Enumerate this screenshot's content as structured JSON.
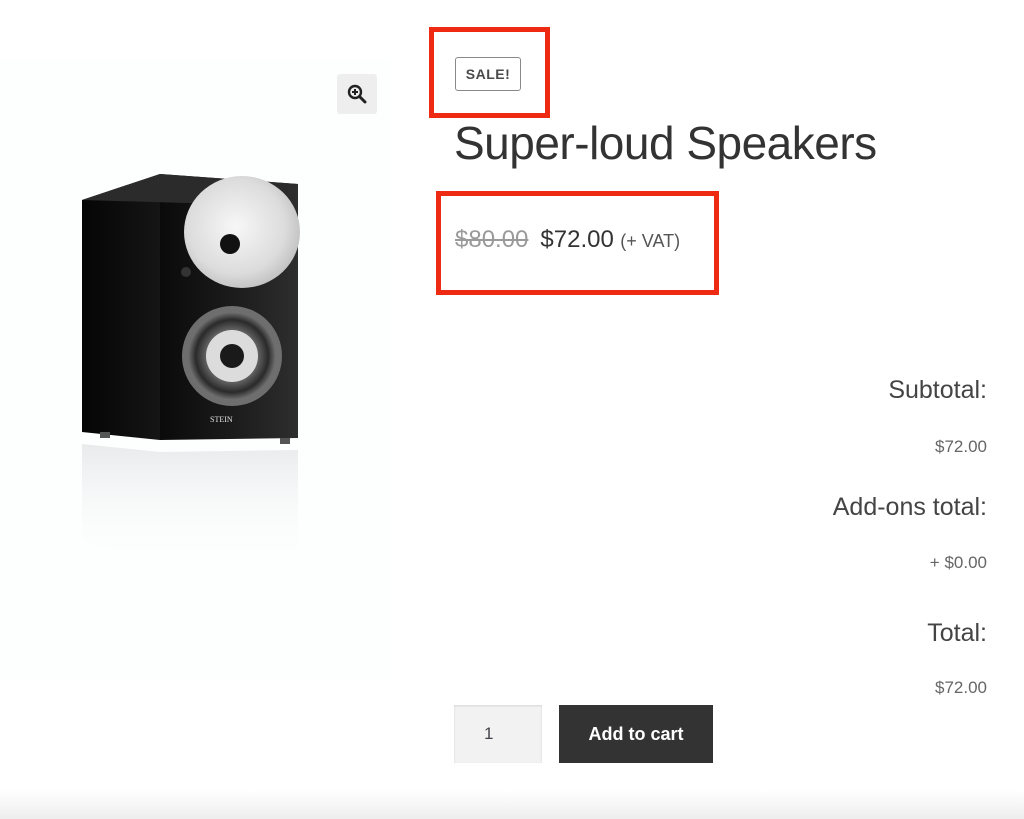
{
  "product": {
    "sale_badge": "SALE!",
    "title": "Super-loud Speakers",
    "price_old": "$80.00",
    "price_new": "$72.00",
    "price_suffix": "(+ VAT)",
    "image_icon": "speaker-image",
    "zoom_icon": "magnifier-zoom-icon"
  },
  "totals": {
    "subtotal_label": "Subtotal:",
    "subtotal_value": "$72.00",
    "addons_label": "Add-ons total:",
    "addons_value": "+ $0.00",
    "total_label": "Total:",
    "total_value": "$72.00"
  },
  "cart": {
    "quantity": "1",
    "add_to_cart_label": "Add to cart"
  },
  "colors": {
    "highlight": "#ee2a13",
    "button": "#333333"
  }
}
